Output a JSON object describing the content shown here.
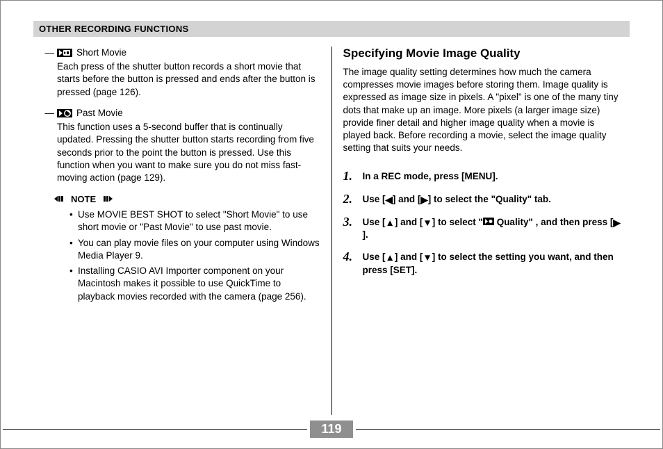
{
  "header": {
    "section_title": "OTHER RECORDING FUNCTIONS"
  },
  "left": {
    "movies": [
      {
        "icon": "short-movie-icon",
        "title": "Short Movie",
        "body": "Each press of the shutter button records a short movie that starts before the button is pressed and ends after the button is pressed (page 126)."
      },
      {
        "icon": "past-movie-icon",
        "title": "Past Movie",
        "body": "This function uses a 5-second buffer that is continually updated. Pressing the shutter button starts recording from five seconds prior to the point the button is pressed. Use this function when you want to make sure you do not miss fast-moving action (page 129)."
      }
    ],
    "note_label": "NOTE",
    "notes": [
      "Use MOVIE BEST SHOT to select \"Short Movie\" to use short movie or \"Past Movie\" to use past movie.",
      "You can play movie files on your computer using Windows Media Player 9.",
      "Installing CASIO AVI Importer component on your Macintosh makes it possible to use QuickTime to playback movies recorded with the camera (page 256)."
    ]
  },
  "right": {
    "heading": "Specifying Movie Image Quality",
    "intro": "The image quality setting determines how much the camera compresses movie images before storing them. Image quality is expressed as image size in pixels. A \"pixel\" is one of the many tiny dots that make up an image. More pixels (a larger image size) provide finer detail and higher image quality when a movie is played back. Before recording a movie, select the image quality setting that suits your needs.",
    "steps": [
      {
        "num": "1",
        "text_parts": [
          "In a REC mode, press [MENU]."
        ]
      },
      {
        "num": "2",
        "text_parts": [
          "Use [",
          "◀",
          "] and [",
          "▶",
          "] to select the \"Quality\" tab."
        ]
      },
      {
        "num": "3",
        "text_parts": [
          "Use [",
          "▲",
          "] and [",
          "▼",
          "] to select \"",
          "ICON_MOVIE",
          " Quality\" , and then press [",
          "▶",
          "]."
        ]
      },
      {
        "num": "4",
        "text_parts": [
          "Use [",
          "▲",
          "] and [",
          "▼",
          "] to select the setting you want, and then press [SET]."
        ]
      }
    ]
  },
  "page_number": "119"
}
